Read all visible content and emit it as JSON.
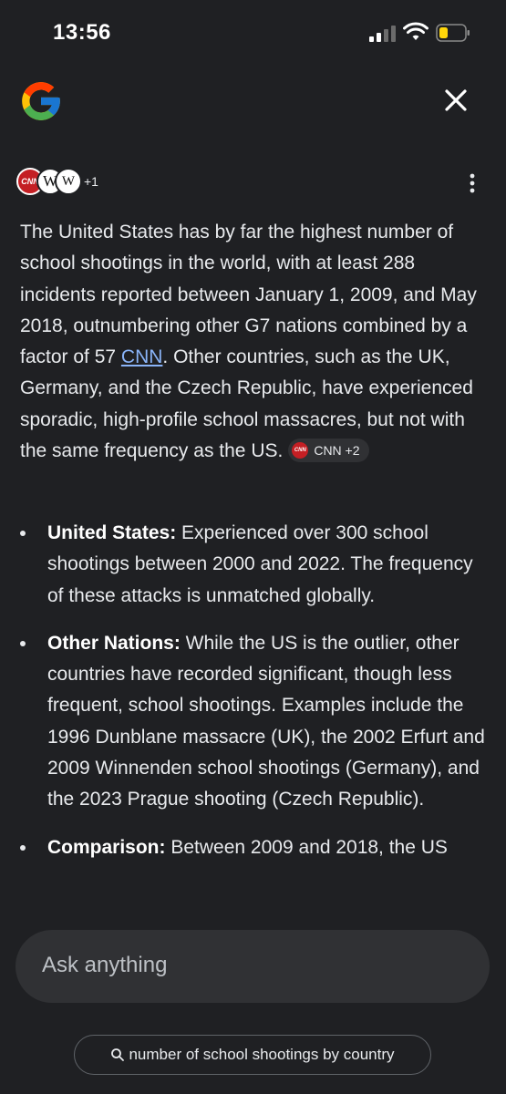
{
  "status": {
    "time": "13:56"
  },
  "header": {
    "logo_icon": "google-g-logo",
    "close_icon": "close-icon"
  },
  "sources": {
    "icons": [
      "cnn",
      "wikipedia",
      "wikipedia"
    ],
    "count_label": "+1"
  },
  "answer": {
    "paragraph_part1": "The United States has by far the highest number of school shootings in the world, with at least 288 incidents reported between January 1, 2009, and May 2018, outnumbering other G7 nations combined by a factor of 57 ",
    "link_label": "CNN",
    "paragraph_part2": ". Other countries, such as the UK, Germany, and the Czech Republic, have experienced sporadic, high-profile school massacres, but not with the same frequency as the US.",
    "chip_label": "CNN +2"
  },
  "bullets": [
    {
      "title": "United States:",
      "text": " Experienced over 300 school shootings between 2000 and 2022. The frequency of these attacks is unmatched globally."
    },
    {
      "title": "Other Nations:",
      "text": " While the US is the outlier, other countries have recorded significant, though less frequent, school shootings. Examples include the 1996 Dunblane massacre (UK), the 2002 Erfurt and 2009 Winnenden school shootings (Germany), and the 2023 Prague shooting (Czech Republic)."
    },
    {
      "title": "Comparison:",
      "text": " Between 2009 and 2018, the US"
    }
  ],
  "ask": {
    "placeholder": "Ask anything"
  },
  "suggestion": {
    "label": "number of school shootings by country"
  },
  "colors": {
    "background": "#1f2023",
    "link": "#8ab4f8",
    "cnn_red": "#c41f24",
    "input_bg": "#303134"
  }
}
